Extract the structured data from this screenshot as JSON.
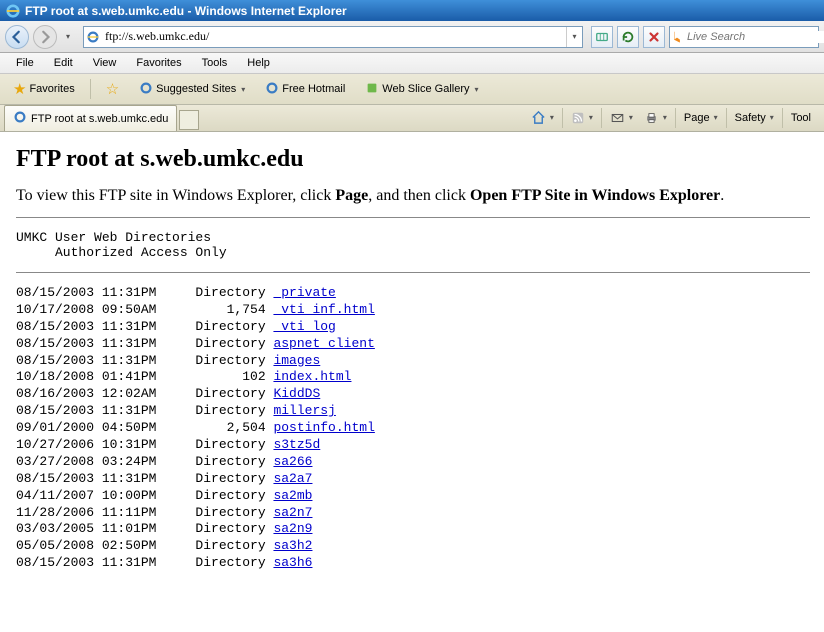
{
  "window": {
    "title": "FTP root at s.web.umkc.edu - Windows Internet Explorer"
  },
  "address": {
    "url": "ftp://s.web.umkc.edu/",
    "search_placeholder": "Live Search"
  },
  "menubar": [
    "File",
    "Edit",
    "View",
    "Favorites",
    "Tools",
    "Help"
  ],
  "favbar": {
    "favorites_label": "Favorites",
    "suggested": "Suggested Sites",
    "free_hotmail": "Free Hotmail",
    "web_slice": "Web Slice Gallery"
  },
  "tab": {
    "title": "FTP root at s.web.umkc.edu"
  },
  "toolbar_right": {
    "page": "Page",
    "safety": "Safety",
    "tools": "Tool"
  },
  "page": {
    "heading": "FTP root at s.web.umkc.edu",
    "instr1": "To view this FTP site in Windows Explorer, click ",
    "instr_page": "Page",
    "instr2": ", and then click ",
    "instr_open": "Open FTP Site in Windows Explorer",
    "instr3": ".",
    "banner_l1": "UMKC User Web Directories",
    "banner_l2": "     Authorized Access Only"
  },
  "listing": [
    {
      "date": "08/15/2003",
      "time": "11:31PM",
      "size": "Directory",
      "name": "_private"
    },
    {
      "date": "10/17/2008",
      "time": "09:50AM",
      "size": "1,754",
      "name": "_vti_inf.html"
    },
    {
      "date": "08/15/2003",
      "time": "11:31PM",
      "size": "Directory",
      "name": "_vti_log"
    },
    {
      "date": "08/15/2003",
      "time": "11:31PM",
      "size": "Directory",
      "name": "aspnet_client"
    },
    {
      "date": "08/15/2003",
      "time": "11:31PM",
      "size": "Directory",
      "name": "images"
    },
    {
      "date": "10/18/2008",
      "time": "01:41PM",
      "size": "102",
      "name": "index.html"
    },
    {
      "date": "08/16/2003",
      "time": "12:02AM",
      "size": "Directory",
      "name": "KiddDS"
    },
    {
      "date": "08/15/2003",
      "time": "11:31PM",
      "size": "Directory",
      "name": "millersj"
    },
    {
      "date": "09/01/2000",
      "time": "04:50PM",
      "size": "2,504",
      "name": "postinfo.html"
    },
    {
      "date": "10/27/2006",
      "time": "10:31PM",
      "size": "Directory",
      "name": "s3tz5d"
    },
    {
      "date": "03/27/2008",
      "time": "03:24PM",
      "size": "Directory",
      "name": "sa266"
    },
    {
      "date": "08/15/2003",
      "time": "11:31PM",
      "size": "Directory",
      "name": "sa2a7"
    },
    {
      "date": "04/11/2007",
      "time": "10:00PM",
      "size": "Directory",
      "name": "sa2mb"
    },
    {
      "date": "11/28/2006",
      "time": "11:11PM",
      "size": "Directory",
      "name": "sa2n7"
    },
    {
      "date": "03/03/2005",
      "time": "11:01PM",
      "size": "Directory",
      "name": "sa2n9"
    },
    {
      "date": "05/05/2008",
      "time": "02:50PM",
      "size": "Directory",
      "name": "sa3h2"
    },
    {
      "date": "08/15/2003",
      "time": "11:31PM",
      "size": "Directory",
      "name": "sa3h6"
    }
  ]
}
